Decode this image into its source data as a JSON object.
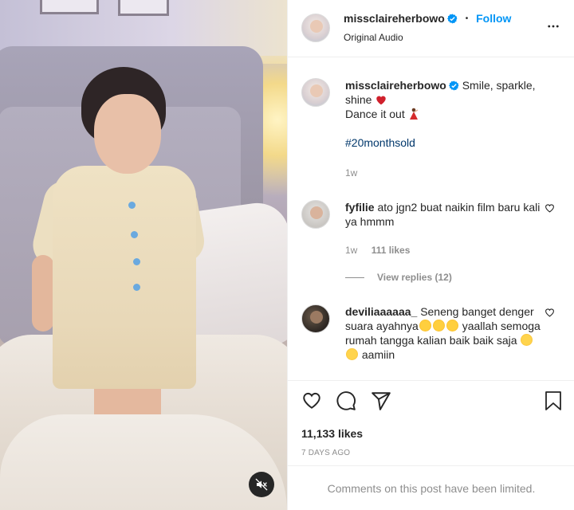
{
  "post": {
    "username": "missclaireherbowo",
    "follow_label": "Follow",
    "separator": "•",
    "audio_label": "Original Audio"
  },
  "caption": {
    "username": "missclaireherbowo",
    "line1": "Smile, sparkle,",
    "line2": "shine",
    "line3": "Dance it out",
    "hashtag": "#20monthsold",
    "time": "1w"
  },
  "comments": [
    {
      "username": "fyfilie",
      "text": "ato jgn2 buat naikin film baru kali ya hmmm",
      "time": "1w",
      "likes": "111 likes",
      "view_replies": "View replies (12)"
    },
    {
      "username": "deviliaaaaaa_",
      "text_part1": "Seneng banget denger suara ayahnya",
      "text_part2": "yaallah semoga rumah tangga kalian baik baik saja",
      "text_part3": "aamiin"
    }
  ],
  "stats": {
    "likes": "11,133 likes",
    "date": "7 DAYS AGO"
  },
  "footer": {
    "limited": "Comments on this post have been limited."
  },
  "icons": {
    "verified": "verified-badge-icon",
    "more": "more-options-icon",
    "heart": "heart-icon",
    "comment": "comment-icon",
    "share": "share-icon",
    "save": "bookmark-icon",
    "mute": "muted-speaker-icon"
  },
  "colors": {
    "accent": "#0095f6",
    "hashtag": "#00376b",
    "muted": "#8e8e8e",
    "text": "#262626"
  }
}
